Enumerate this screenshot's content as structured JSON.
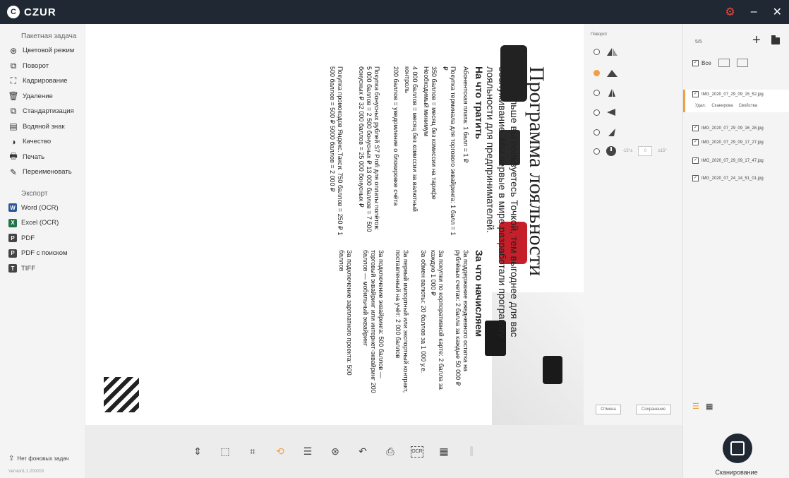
{
  "app": {
    "logo_text": "CZUR",
    "logo_mark": "C",
    "minimize": "–",
    "close": "✕",
    "settings_icon": "gear-icon"
  },
  "sidebar": {
    "batch_label": "Пакетная задача",
    "items": [
      {
        "label": "Цветовой режим",
        "icon": "color-mode-icon"
      },
      {
        "label": "Поворот",
        "icon": "rotate-icon"
      },
      {
        "label": "Кадрирование",
        "icon": "crop-icon"
      },
      {
        "label": "Удаление",
        "icon": "trash-icon"
      },
      {
        "label": "Стандартизация",
        "icon": "standardize-icon"
      },
      {
        "label": "Водяной знак",
        "icon": "watermark-icon"
      },
      {
        "label": "Качество",
        "icon": "quality-icon"
      },
      {
        "label": "Печать",
        "icon": "print-icon"
      },
      {
        "label": "Переименовать",
        "icon": "rename-icon"
      }
    ],
    "export_label": "Экспорт",
    "exports": [
      {
        "label": "Word (OCR)",
        "badge": "W",
        "color": "#2b579a"
      },
      {
        "label": "Excel (OCR)",
        "badge": "X",
        "color": "#217346"
      },
      {
        "label": "PDF",
        "badge": "P",
        "color": "#444444"
      },
      {
        "label": "PDF с поиском",
        "badge": "P",
        "color": "#444444"
      },
      {
        "label": "TIFF",
        "badge": "T",
        "color": "#444444"
      }
    ],
    "bg_tasks": "Нет фоновых задач",
    "version": "Version1.1.200203"
  },
  "document": {
    "title": "Программа лояльности",
    "subtitle": "Чем больше вы пользуетесь Точкой, тем выгоднее для вас обслуживание. Мы первые в мире разработали программу лояльности для предпринимателей.",
    "earn_heading": "За что начисляем",
    "earn_items": [
      "За поддержание ежедневного остатка на рублёвых счетах: 2 балла за каждые 50 000 ₽",
      "За покупки по корпоративной карте: 2 балла за каждую 1 000 ₽",
      "За обмен валюты: 20 баллов за 1 000 у.е.",
      "За первый импортный или экспортный контракт, поставленный на учёт: 2 000 баллов",
      "За подключение эквайринга: 500 баллов — торговый эквайринг или интернет-эквайринг 200 баллов — мобильный эквайринг",
      "За подключение зарплатного проекта: 500 баллов"
    ],
    "spend_heading": "На что тратить",
    "spend_items": [
      "Абонентская плата: 1 балл = 1 ₽",
      "Покупка терминала для торгового эквайринга: 1 балл = 1 ₽",
      "350 баллов = месяц без комиссии на тарифе Необходимый минимум",
      "4 000 баллов = месяц без комиссии за валютный контроль",
      "200 баллов = уведомление о блокировке счёта",
      "Покупка бонусных рублей S7 Profi для оплаты полётов: 5 000 баллов = 2 500 бонусных ₽ 13 000 баллов = 7 500 бонусных ₽ 32 000 баллов = 25 000 бонусных ₽",
      "Покупка промокодов Яндекс.Такси: 750 баллов = 250 ₽ 1 500 баллов = 500 ₽ 5000 баллов = 2 000 ₽"
    ]
  },
  "rotation": {
    "label": "Поворот",
    "deg_min": "-15°±",
    "deg_value": "0",
    "deg_max": "±15°",
    "cancel": "Отмена",
    "save": "Сохранение"
  },
  "files": {
    "count": "5/5",
    "all_label": "Все",
    "items": [
      "IMG_2020_07_29_09_15_52.jpg",
      "IMG_2020_07_29_09_16_28.jpg",
      "IMG_2020_07_29_09_17_27.jpg",
      "IMG_2020_07_29_09_17_47.jpg",
      "IMG_2020_07_24_14_51_01.jpg"
    ],
    "actions": [
      "Удал.",
      "Сканирова",
      "Свойства"
    ],
    "scan_label": "Сканирование"
  }
}
